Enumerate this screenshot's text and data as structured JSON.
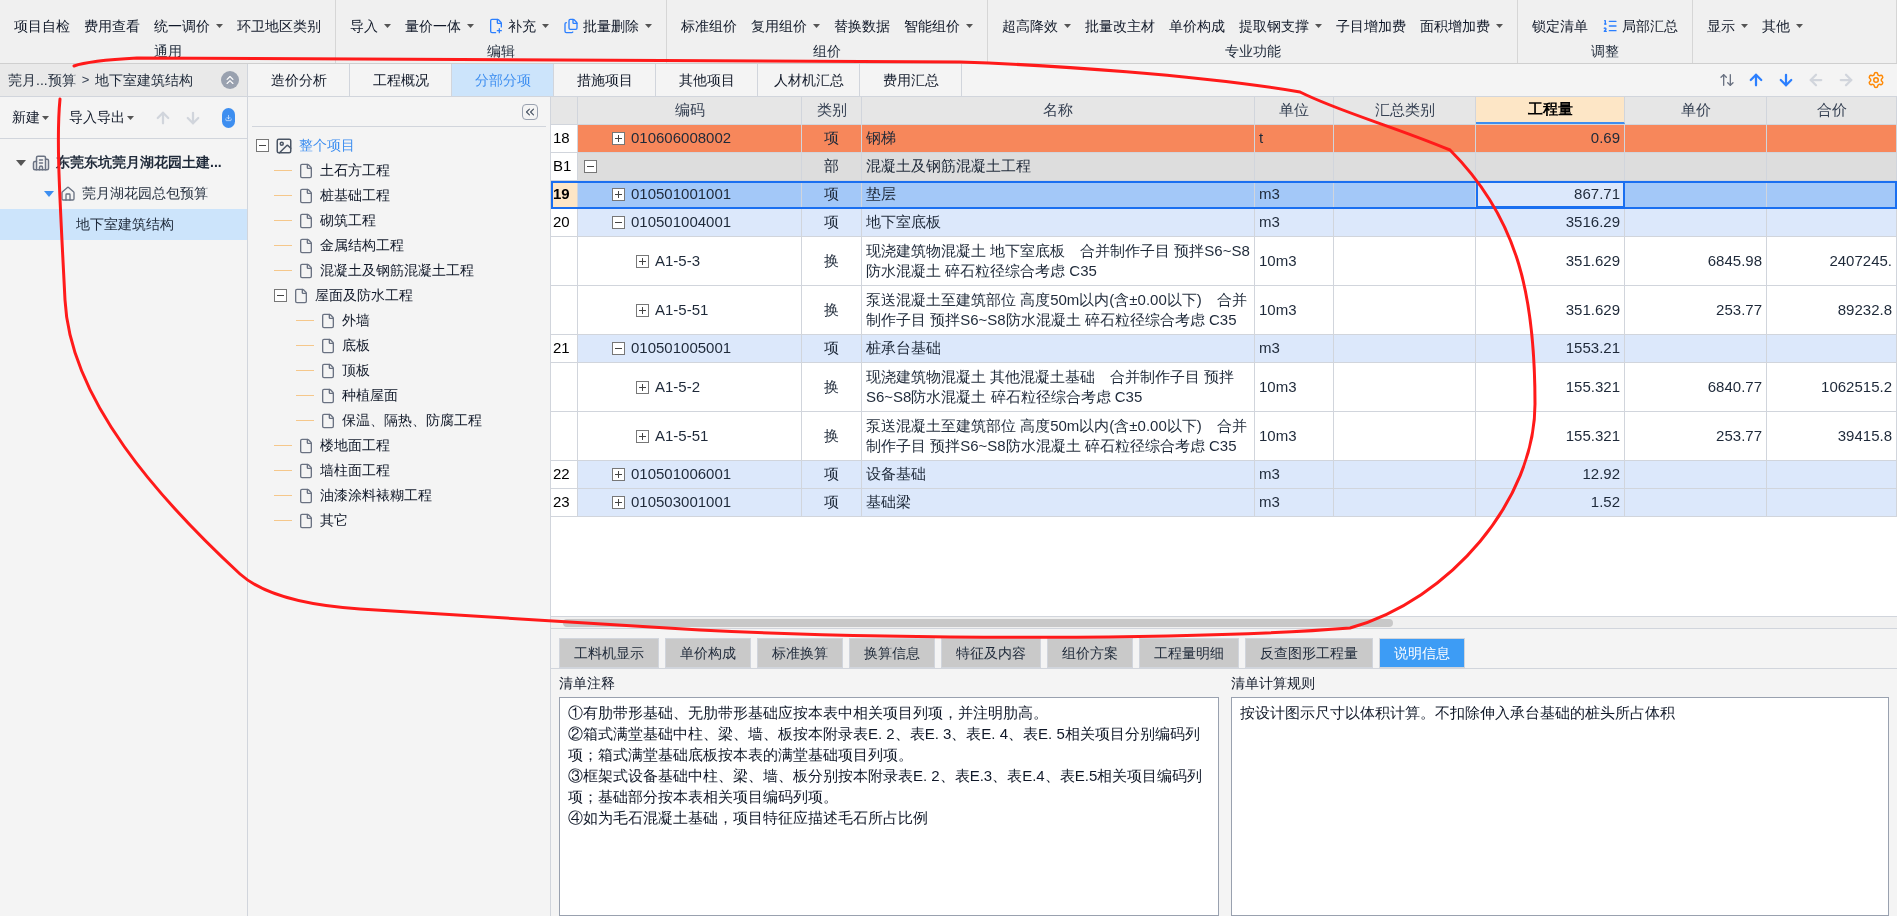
{
  "toolbar": {
    "groups": [
      {
        "label": "通用",
        "items": [
          {
            "label": "项目自检",
            "kind": "plain",
            "dropdown": false
          },
          {
            "label": "费用查看",
            "kind": "plain",
            "dropdown": false
          },
          {
            "label": "统一调价",
            "kind": "plain",
            "dropdown": true
          },
          {
            "label": "环卫地区类别",
            "kind": "plain",
            "dropdown": false
          }
        ]
      },
      {
        "label": "编辑",
        "items": [
          {
            "label": "导入",
            "kind": "plain",
            "dropdown": true
          },
          {
            "label": "量价一体",
            "kind": "plain",
            "dropdown": true
          },
          {
            "label": "补充",
            "kind": "add",
            "dropdown": true
          },
          {
            "label": "批量删除",
            "kind": "delete",
            "dropdown": true
          }
        ]
      },
      {
        "label": "组价",
        "items": [
          {
            "label": "标准组价",
            "kind": "plain",
            "dropdown": false
          },
          {
            "label": "复用组价",
            "kind": "plain",
            "dropdown": true
          },
          {
            "label": "替换数据",
            "kind": "plain",
            "dropdown": false
          },
          {
            "label": "智能组价",
            "kind": "plain",
            "dropdown": true
          }
        ]
      },
      {
        "label": "专业功能",
        "items": [
          {
            "label": "超高降效",
            "kind": "plain",
            "dropdown": true
          },
          {
            "label": "批量改主材",
            "kind": "plain",
            "dropdown": false
          },
          {
            "label": "单价构成",
            "kind": "plain",
            "dropdown": false
          },
          {
            "label": "提取钢支撑",
            "kind": "plain",
            "dropdown": true
          },
          {
            "label": "子目增加费",
            "kind": "plain",
            "dropdown": false
          },
          {
            "label": "面积增加费",
            "kind": "plain",
            "dropdown": true
          }
        ]
      },
      {
        "label": "调整",
        "items": [
          {
            "label": "锁定清单",
            "kind": "plain",
            "dropdown": false
          },
          {
            "label": "局部汇总",
            "kind": "summary",
            "dropdown": false
          }
        ]
      },
      {
        "items": [
          {
            "label": "显示",
            "kind": "plain",
            "dropdown": true
          },
          {
            "label": "其他",
            "kind": "plain",
            "dropdown": true
          }
        ]
      }
    ]
  },
  "breadcrumb": {
    "parent": "莞月...预算",
    "separator": ">",
    "current": "地下室建筑结构"
  },
  "project_toolbar": {
    "buttons": [
      {
        "label": "新建",
        "dropdown": true
      },
      {
        "label": "导入导出",
        "dropdown": true
      }
    ],
    "moves": [
      {
        "kind": "up",
        "disabled": true
      },
      {
        "kind": "down",
        "disabled": true
      }
    ]
  },
  "project_tree": [
    {
      "label": "东莞东坑莞月湖花园土建...",
      "kind": "project",
      "expanded": true,
      "selected": false,
      "children": [
        {
          "label": "莞月湖花园总包预算",
          "kind": "budget",
          "expanded": true,
          "selected": false,
          "children": [
            {
              "label": "地下室建筑结构",
              "kind": "unit",
              "selected": true
            }
          ]
        }
      ]
    }
  ],
  "tabs": [
    {
      "label": "造价分析",
      "selected": false
    },
    {
      "label": "工程概况",
      "selected": false
    },
    {
      "label": "分部分项",
      "selected": true
    },
    {
      "label": "措施项目",
      "selected": false
    },
    {
      "label": "其他项目",
      "selected": false
    },
    {
      "label": "人材机汇总",
      "selected": false
    },
    {
      "label": "费用汇总",
      "selected": false
    }
  ],
  "grid_nav": [
    {
      "kind": "up",
      "disabled": false
    },
    {
      "kind": "down",
      "disabled": false
    },
    {
      "kind": "left",
      "disabled": true
    },
    {
      "kind": "right",
      "disabled": true
    }
  ],
  "section_tree": [
    {
      "label": "整个项目",
      "kind": "root",
      "expanded": true,
      "selected": true,
      "children": [
        {
          "label": "土石方工程",
          "kind": "page",
          "selected": false
        },
        {
          "label": "桩基础工程",
          "kind": "page",
          "selected": false
        },
        {
          "label": "砌筑工程",
          "kind": "page",
          "selected": false
        },
        {
          "label": "金属结构工程",
          "kind": "page",
          "selected": false
        },
        {
          "label": "混凝土及钢筋混凝土工程",
          "kind": "page",
          "selected": false
        },
        {
          "label": "屋面及防水工程",
          "kind": "page",
          "expanded": true,
          "selected": false,
          "children": [
            {
              "label": "外墙",
              "kind": "page",
              "selected": false
            },
            {
              "label": "底板",
              "kind": "page",
              "selected": false
            },
            {
              "label": "顶板",
              "kind": "page",
              "selected": false
            },
            {
              "label": "种植屋面",
              "kind": "page",
              "selected": false
            },
            {
              "label": "保温、隔热、防腐工程",
              "kind": "page",
              "selected": false
            }
          ]
        },
        {
          "label": "楼地面工程",
          "kind": "page",
          "selected": false
        },
        {
          "label": "墙柱面工程",
          "kind": "page",
          "selected": false
        },
        {
          "label": "油漆涂料裱糊工程",
          "kind": "page",
          "selected": false
        },
        {
          "label": "其它",
          "kind": "page",
          "selected": false
        }
      ]
    }
  ],
  "table": {
    "columns": [
      {
        "label": "编码",
        "selected": false
      },
      {
        "label": "类别",
        "selected": false
      },
      {
        "label": "名称",
        "selected": false
      },
      {
        "label": "单位",
        "selected": false
      },
      {
        "label": "汇总类别",
        "selected": false
      },
      {
        "label": "工程量",
        "selected": true
      },
      {
        "label": "单价",
        "selected": false
      },
      {
        "label": "合价",
        "selected": false
      }
    ],
    "rows": [
      {
        "num": "18",
        "code": "010606008002",
        "expanded": false,
        "type": "项",
        "name": "钢梯",
        "unit": "t",
        "qty": "0.69",
        "kind": "item",
        "color": "#f7875b",
        "selected": false
      },
      {
        "num": "B1",
        "expanded": true,
        "type": "部",
        "name": "混凝土及钢筋混凝土工程",
        "kind": "section",
        "color": "#dddddd",
        "selected": false
      },
      {
        "num": "19",
        "code": "010501001001",
        "expanded": false,
        "type": "项",
        "name": "垫层",
        "unit": "m3",
        "qty": "867.71",
        "kind": "item",
        "color": "#a3c8f8",
        "selected": true
      },
      {
        "num": "20",
        "code": "010501004001",
        "expanded": true,
        "type": "项",
        "name": "地下室底板",
        "unit": "m3",
        "qty": "3516.29",
        "kind": "item",
        "color": "#dce8fb",
        "selected": false
      },
      {
        "code": "A1-5-3",
        "expanded": false,
        "type": "换",
        "name": "现浇建筑物混凝土 地下室底板　合并制作子目 预拌S6~S8防水混凝土 碎石粒径综合考虑 C35",
        "unit": "10m3",
        "qty": "351.629",
        "price": "6845.98",
        "total": "2407245.",
        "kind": "sub",
        "color": "#ffffff",
        "selected": false
      },
      {
        "code": "A1-5-51",
        "expanded": false,
        "type": "换",
        "name": "泵送混凝土至建筑部位 高度50m以内(含±0.00以下)　合并制作子目 预拌S6~S8防水混凝土 碎石粒径综合考虑 C35",
        "unit": "10m3",
        "qty": "351.629",
        "price": "253.77",
        "total": "89232.8",
        "kind": "sub",
        "color": "#ffffff",
        "selected": false
      },
      {
        "num": "21",
        "code": "010501005001",
        "expanded": true,
        "type": "项",
        "name": "桩承台基础",
        "unit": "m3",
        "qty": "1553.21",
        "kind": "item",
        "color": "#dce8fb",
        "selected": false
      },
      {
        "code": "A1-5-2",
        "expanded": false,
        "type": "换",
        "name": "现浇建筑物混凝土 其他混凝土基础　合并制作子目 预拌S6~S8防水混凝土 碎石粒径综合考虑 C35",
        "unit": "10m3",
        "qty": "155.321",
        "price": "6840.77",
        "total": "1062515.2",
        "kind": "sub",
        "color": "#ffffff",
        "selected": false
      },
      {
        "code": "A1-5-51",
        "expanded": false,
        "type": "换",
        "name": "泵送混凝土至建筑部位 高度50m以内(含±0.00以下)　合并制作子目 预拌S6~S8防水混凝土 碎石粒径综合考虑 C35",
        "unit": "10m3",
        "qty": "155.321",
        "price": "253.77",
        "total": "39415.8",
        "kind": "sub",
        "color": "#ffffff",
        "selected": false
      },
      {
        "num": "22",
        "code": "010501006001",
        "expanded": false,
        "type": "项",
        "name": "设备基础",
        "unit": "m3",
        "qty": "12.92",
        "kind": "item",
        "color": "#dce8fb",
        "selected": false
      },
      {
        "num": "23",
        "code": "010503001001",
        "expanded": false,
        "type": "项",
        "name": "基础梁",
        "unit": "m3",
        "qty": "1.52",
        "kind": "item",
        "color": "#dce8fb",
        "selected": false
      }
    ]
  },
  "detail_tabs": [
    {
      "label": "工料机显示",
      "selected": false
    },
    {
      "label": "单价构成",
      "selected": false
    },
    {
      "label": "标准换算",
      "selected": false
    },
    {
      "label": "换算信息",
      "selected": false
    },
    {
      "label": "特征及内容",
      "selected": false
    },
    {
      "label": "组价方案",
      "selected": false
    },
    {
      "label": "工程量明细",
      "selected": false
    },
    {
      "label": "反查图形工程量",
      "selected": false
    },
    {
      "label": "说明信息",
      "selected": true
    }
  ],
  "notes": {
    "label": "清单注释",
    "paragraphs": [
      "①有肋带形基础、无肋带形基础应按本表中相关项目列项，并注明肋高。",
      "②箱式满堂基础中柱、梁、墙、板按本附录表E. 2、表E. 3、表E. 4、表E. 5相关项目分别编码列项；箱式满堂基础底板按本表的满堂基础项目列项。",
      "③框架式设备基础中柱、梁、墙、板分别按本附录表E. 2、表E.3、表E.4、表E.5相关项目编码列项；基础部分按本表相关项目编码列项。",
      "④如为毛石混凝土基础，项目特征应描述毛石所占比例"
    ]
  },
  "rules": {
    "label": "清单计算规则",
    "text": "按设计图示尺寸以体积计算。不扣除伸入承台基础的桩头所占体积"
  }
}
